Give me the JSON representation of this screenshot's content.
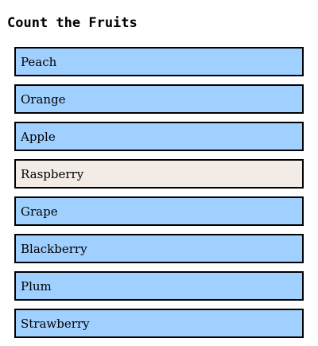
{
  "title": "Count the Fruits",
  "colors": {
    "default_item": "#a0d0ff",
    "highlighted_item": "#f3ebe6",
    "border": "#000000"
  },
  "items": [
    {
      "label": "Peach",
      "highlighted": false
    },
    {
      "label": "Orange",
      "highlighted": false
    },
    {
      "label": "Apple",
      "highlighted": false
    },
    {
      "label": "Raspberry",
      "highlighted": true
    },
    {
      "label": "Grape",
      "highlighted": false
    },
    {
      "label": "Blackberry",
      "highlighted": false
    },
    {
      "label": "Plum",
      "highlighted": false
    },
    {
      "label": "Strawberry",
      "highlighted": false
    }
  ]
}
